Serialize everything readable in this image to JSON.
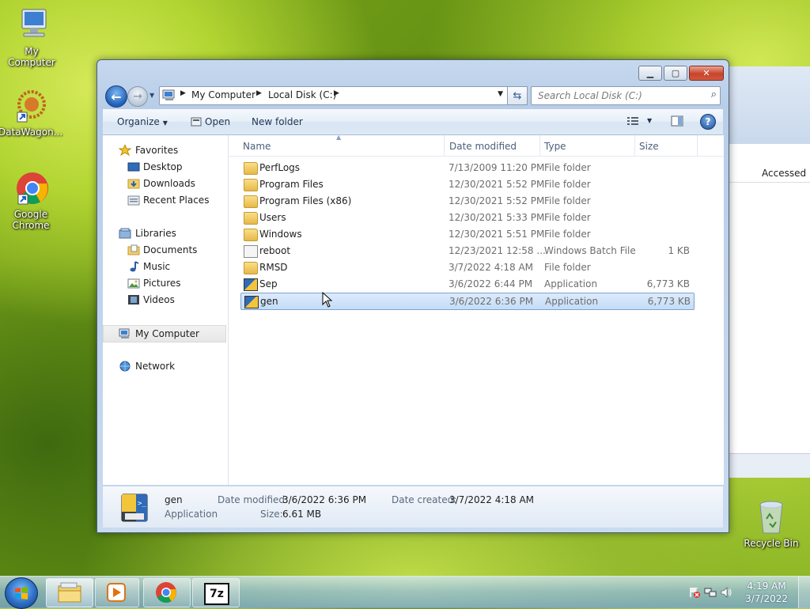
{
  "desktop": {
    "icons": [
      {
        "label": "My Computer"
      },
      {
        "label": "DataWagon..."
      },
      {
        "label": "Google Chrome"
      },
      {
        "label": "Recycle Bin"
      }
    ]
  },
  "background_window": {
    "column_label": "Accessed"
  },
  "window": {
    "address": {
      "crumbs": [
        "My Computer",
        "Local Disk (C:)"
      ]
    },
    "search": {
      "placeholder": "Search Local Disk (C:)"
    },
    "toolbar": {
      "organize": "Organize",
      "open": "Open",
      "new_folder": "New folder"
    },
    "nav": {
      "favorites": "Favorites",
      "desktop": "Desktop",
      "downloads": "Downloads",
      "recent": "Recent Places",
      "libraries": "Libraries",
      "documents": "Documents",
      "music": "Music",
      "pictures": "Pictures",
      "videos": "Videos",
      "computer": "My Computer",
      "network": "Network"
    },
    "columns": {
      "name": "Name",
      "date": "Date modified",
      "type": "Type",
      "size": "Size"
    },
    "files": [
      {
        "name": "PerfLogs",
        "date": "7/13/2009 11:20 PM",
        "type": "File folder",
        "size": "",
        "kind": "folder"
      },
      {
        "name": "Program Files",
        "date": "12/30/2021 5:52 PM",
        "type": "File folder",
        "size": "",
        "kind": "folder"
      },
      {
        "name": "Program Files (x86)",
        "date": "12/30/2021 5:52 PM",
        "type": "File folder",
        "size": "",
        "kind": "folder"
      },
      {
        "name": "Users",
        "date": "12/30/2021 5:33 PM",
        "type": "File folder",
        "size": "",
        "kind": "folder"
      },
      {
        "name": "Windows",
        "date": "12/30/2021 5:51 PM",
        "type": "File folder",
        "size": "",
        "kind": "folder"
      },
      {
        "name": "reboot",
        "date": "12/23/2021 12:58 ...",
        "type": "Windows Batch File",
        "size": "1 KB",
        "kind": "batch"
      },
      {
        "name": "RMSD",
        "date": "3/7/2022 4:18 AM",
        "type": "File folder",
        "size": "",
        "kind": "folder"
      },
      {
        "name": "Sep",
        "date": "3/6/2022 6:44 PM",
        "type": "Application",
        "size": "6,773 KB",
        "kind": "app"
      },
      {
        "name": "gen",
        "date": "3/6/2022 6:36 PM",
        "type": "Application",
        "size": "6,773 KB",
        "kind": "app"
      }
    ],
    "details": {
      "name": "gen",
      "type": "Application",
      "modified_label": "Date modified:",
      "modified_value": "3/6/2022 6:36 PM",
      "created_label": "Date created:",
      "created_value": "3/7/2022 4:18 AM",
      "size_label": "Size:",
      "size_value": "6.61 MB"
    }
  },
  "taskbar": {
    "time": "4:19 AM",
    "date": "3/7/2022",
    "sevenzip_label": "7z"
  }
}
